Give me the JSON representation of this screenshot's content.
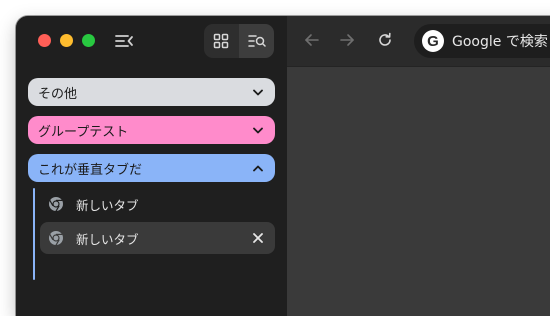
{
  "window": {
    "traffic_lights": [
      "close",
      "minimize",
      "zoom"
    ]
  },
  "sidebar": {
    "toggle_icon": "collapse-sidebar-icon",
    "view_buttons": [
      {
        "icon": "grid-icon",
        "active": false
      },
      {
        "icon": "search-tabs-icon",
        "active": true
      }
    ],
    "groups": [
      {
        "label": "その他",
        "color": "#dadce0",
        "expanded": false
      },
      {
        "label": "グループテスト",
        "color": "#ff8bcb",
        "expanded": false
      },
      {
        "label": "これが垂直タブだ",
        "color": "#8ab4f8",
        "expanded": true,
        "tabs": [
          {
            "title": "新しいタブ",
            "icon": "chrome-icon",
            "active": false
          },
          {
            "title": "新しいタブ",
            "icon": "chrome-icon",
            "active": true
          }
        ]
      }
    ]
  },
  "toolbar": {
    "back_icon": "back-arrow-icon",
    "forward_icon": "forward-arrow-icon",
    "reload_icon": "reload-icon",
    "omnibox": {
      "badge": "G",
      "text": "Google で検索"
    }
  }
}
